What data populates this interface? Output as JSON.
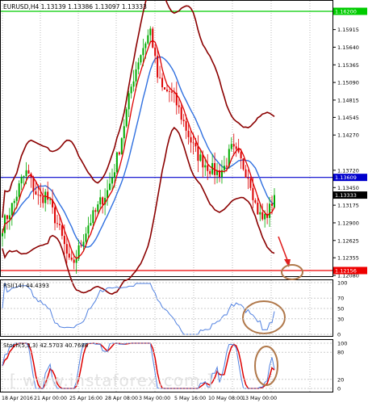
{
  "main_panel": {
    "header": "EURUSD,H4  1.13139 1.13386 1.13097 1.13333",
    "price_ticks": [
      "1.15915",
      "1.15640",
      "1.15365",
      "1.15090",
      "1.14815",
      "1.14545",
      "1.14270",
      "1.13720",
      "1.13450",
      "1.13175",
      "1.12900",
      "1.12625",
      "1.12355",
      "1.12080"
    ],
    "levels": [
      {
        "label": "1.16200",
        "value": 1.162,
        "color": "#00cc00"
      },
      {
        "label": "1.13609",
        "value": 1.13609,
        "color": "#0000cc"
      },
      {
        "label": "1.12156",
        "value": 1.12156,
        "color": "#ee0000"
      }
    ],
    "current_price": {
      "label": "1.13333",
      "value": 1.13333
    }
  },
  "rsi_panel": {
    "header": "RSI(14) 44.4393",
    "ticks": [
      "100",
      "70",
      "50",
      "30",
      "0"
    ]
  },
  "stoch_panel": {
    "header": "Stoch(5,3,3) 42.5703 40.7686",
    "ticks": [
      "100",
      "80",
      "20",
      "0"
    ]
  },
  "time_axis": [
    "18 Apr 2016",
    "21 Apr 00:00",
    "25 Apr 16:00",
    "28 Apr 08:00",
    "3 May 00:00",
    "5 May 16:00",
    "10 May 08:00",
    "13 May 00:00"
  ],
  "watermark": "[ www.instaforex.com ]",
  "colors": {
    "bull": "#00aa00",
    "bear": "#dd0000",
    "ma_fast": "#dd0000",
    "ma_slow": "#3070e0",
    "bands": "#8b0000",
    "oscillator": "#5080e0",
    "highlight": "#b0784a"
  },
  "chart_data": {
    "type": "candlestick",
    "symbol": "EURUSD",
    "timeframe": "H4",
    "ohlc_last": {
      "open": 1.13139,
      "high": 1.13386,
      "low": 1.13097,
      "close": 1.13333
    },
    "close_path": [
      1.1285,
      1.1305,
      1.1325,
      1.1355,
      1.137,
      1.1345,
      1.1325,
      1.1335,
      1.131,
      1.1285,
      1.1255,
      1.122,
      1.1238,
      1.1265,
      1.129,
      1.1305,
      1.1325,
      1.134,
      1.137,
      1.141,
      1.146,
      1.151,
      1.1545,
      1.157,
      1.1592,
      1.152,
      1.1495,
      1.1495,
      1.148,
      1.1455,
      1.143,
      1.1405,
      1.139,
      1.138,
      1.1372,
      1.1368,
      1.1378,
      1.1405,
      1.1395,
      1.1378,
      1.136,
      1.1315,
      1.1295,
      1.1305,
      1.13333
    ],
    "rsi": {
      "period": 14,
      "value": 44.4393
    },
    "stochastic": {
      "params": "5,3,3",
      "k": 42.5703,
      "d": 40.7686
    }
  }
}
